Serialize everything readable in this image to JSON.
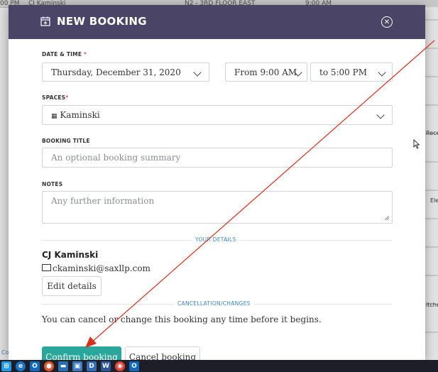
{
  "background": {
    "topbar": [
      "00 PM",
      "CJ Kaminski",
      "N2 - 3RD FLOOR EAST",
      "9:00 AM"
    ],
    "side_labels": [
      "Rece",
      "Ele",
      "itche"
    ],
    "left_edge_label": "Co"
  },
  "modal": {
    "title": "NEW BOOKING",
    "header_icon": "calendar-plus-icon",
    "close_icon": "close-circle-icon",
    "date_time": {
      "label": "DATE & TIME",
      "required_mark": "*",
      "date_value": "Thursday, December 31, 2020",
      "from_value": "From 9:00 AM",
      "to_value": "to 5:00 PM"
    },
    "spaces": {
      "label": "SPACES",
      "required_mark": "*",
      "value": "Kaminski",
      "value_icon": "desk-grid-icon"
    },
    "booking_title": {
      "label": "BOOKING TITLE",
      "placeholder": "An optional booking summary"
    },
    "notes": {
      "label": "NOTES",
      "placeholder": "Any further information"
    },
    "your_details": {
      "section_title": "YOUR DETAILS",
      "name": "CJ Kaminski",
      "email": "ckaminski@saxllp.com",
      "edit_button": "Edit details"
    },
    "cancellation": {
      "section_title": "CANCELLATION/CHANGES",
      "text": "You can cancel or change this booking any time before it begins."
    },
    "actions": {
      "confirm": "Confirm booking",
      "cancel": "Cancel booking"
    }
  },
  "taskbar": {
    "items": [
      "windows-icon",
      "ie-icon",
      "outlook-icon",
      "app-icon",
      "explorer-icon",
      "project-icon",
      "d-app-icon",
      "word-icon",
      "chrome-icon",
      "outlook-icon-2"
    ]
  },
  "colors": {
    "header": "#4a4466",
    "primary": "#2aa79b",
    "section_title": "#3a87c6",
    "required": "#d9534f",
    "annotation_arrow": "#d9301c"
  }
}
